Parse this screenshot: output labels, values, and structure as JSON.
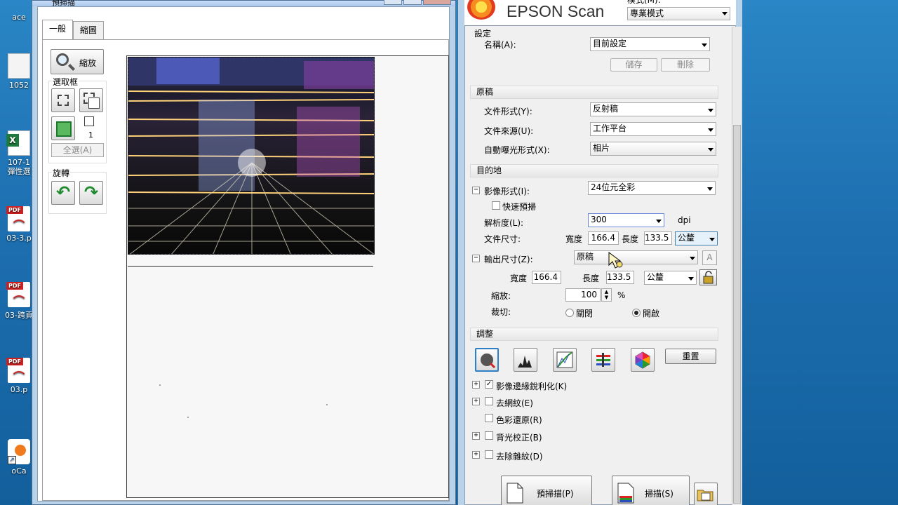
{
  "desktop": {
    "icons": [
      {
        "label": "ace",
        "type": "top"
      },
      {
        "label": "1052",
        "type": "doc"
      },
      {
        "label": "107-1\n彈性選",
        "type": "xls"
      },
      {
        "label": "03-3.p",
        "type": "pdf"
      },
      {
        "label": "03-跨頁",
        "type": "pdf"
      },
      {
        "label": "03.p",
        "type": "pdf"
      },
      {
        "label": "oCa",
        "type": "oca"
      }
    ],
    "pdf_tag": "PDF",
    "xls_tag": "X"
  },
  "preview": {
    "title": "預掃描",
    "tabs": [
      "一般",
      "縮圖"
    ],
    "zoom_label": "縮放",
    "selection_group_title": "選取框",
    "selection_count": "1",
    "select_all_label": "全選(A)",
    "rotate_group_title": "旋轉"
  },
  "epson": {
    "logo": "EPSON Scan",
    "mode_label": "模式(M):",
    "mode_value": "專業模式",
    "settings_title": "設定",
    "name_label": "名稱(A):",
    "name_value": "目前設定",
    "save_label": "儲存",
    "delete_label": "刪除",
    "original": {
      "title": "原稿",
      "doc_type_label": "文件形式(Y):",
      "doc_type_value": "反射稿",
      "doc_source_label": "文件來源(U):",
      "doc_source_value": "工作平台",
      "auto_exposure_label": "自動曝光形式(X):",
      "auto_exposure_value": "相片"
    },
    "destination": {
      "title": "目的地",
      "image_type_label": "影像形式(I):",
      "image_type_value": "24位元全彩",
      "quick_preview_label": "快速預掃",
      "resolution_label": "解析度(L):",
      "resolution_value": "300",
      "dpi": "dpi",
      "doc_size_label": "文件尺寸:",
      "width_label": "寬度",
      "width_value": "166.4",
      "height_label": "長度",
      "height_value": "133.5",
      "unit_value": "公釐",
      "output_size_label": "輸出尺寸(Z):",
      "output_size_value": "原稿",
      "a_glyph": "A",
      "out_width_label": "寬度",
      "out_width_value": "166.4",
      "out_height_label": "長度",
      "out_height_value": "133.5",
      "out_unit_value": "公釐",
      "scale_label": "縮放:",
      "scale_value": "100",
      "percent": "%",
      "trim_label": "裁切:",
      "trim_off": "關閉",
      "trim_on": "開啟"
    },
    "adjust": {
      "title": "調整",
      "reset_label": "重置",
      "options": [
        {
          "label": "影像邊緣銳利化(K)",
          "checked": true,
          "expand": true
        },
        {
          "label": "去網紋(E)",
          "checked": false,
          "expand": true
        },
        {
          "label": "色彩還原(R)",
          "checked": false,
          "expand": false
        },
        {
          "label": "背光校正(B)",
          "checked": false,
          "expand": true
        },
        {
          "label": "去除雜紋(D)",
          "checked": false,
          "expand": true
        }
      ]
    },
    "preview_btn": "預掃描(P)",
    "scan_btn": "掃描(S)"
  }
}
